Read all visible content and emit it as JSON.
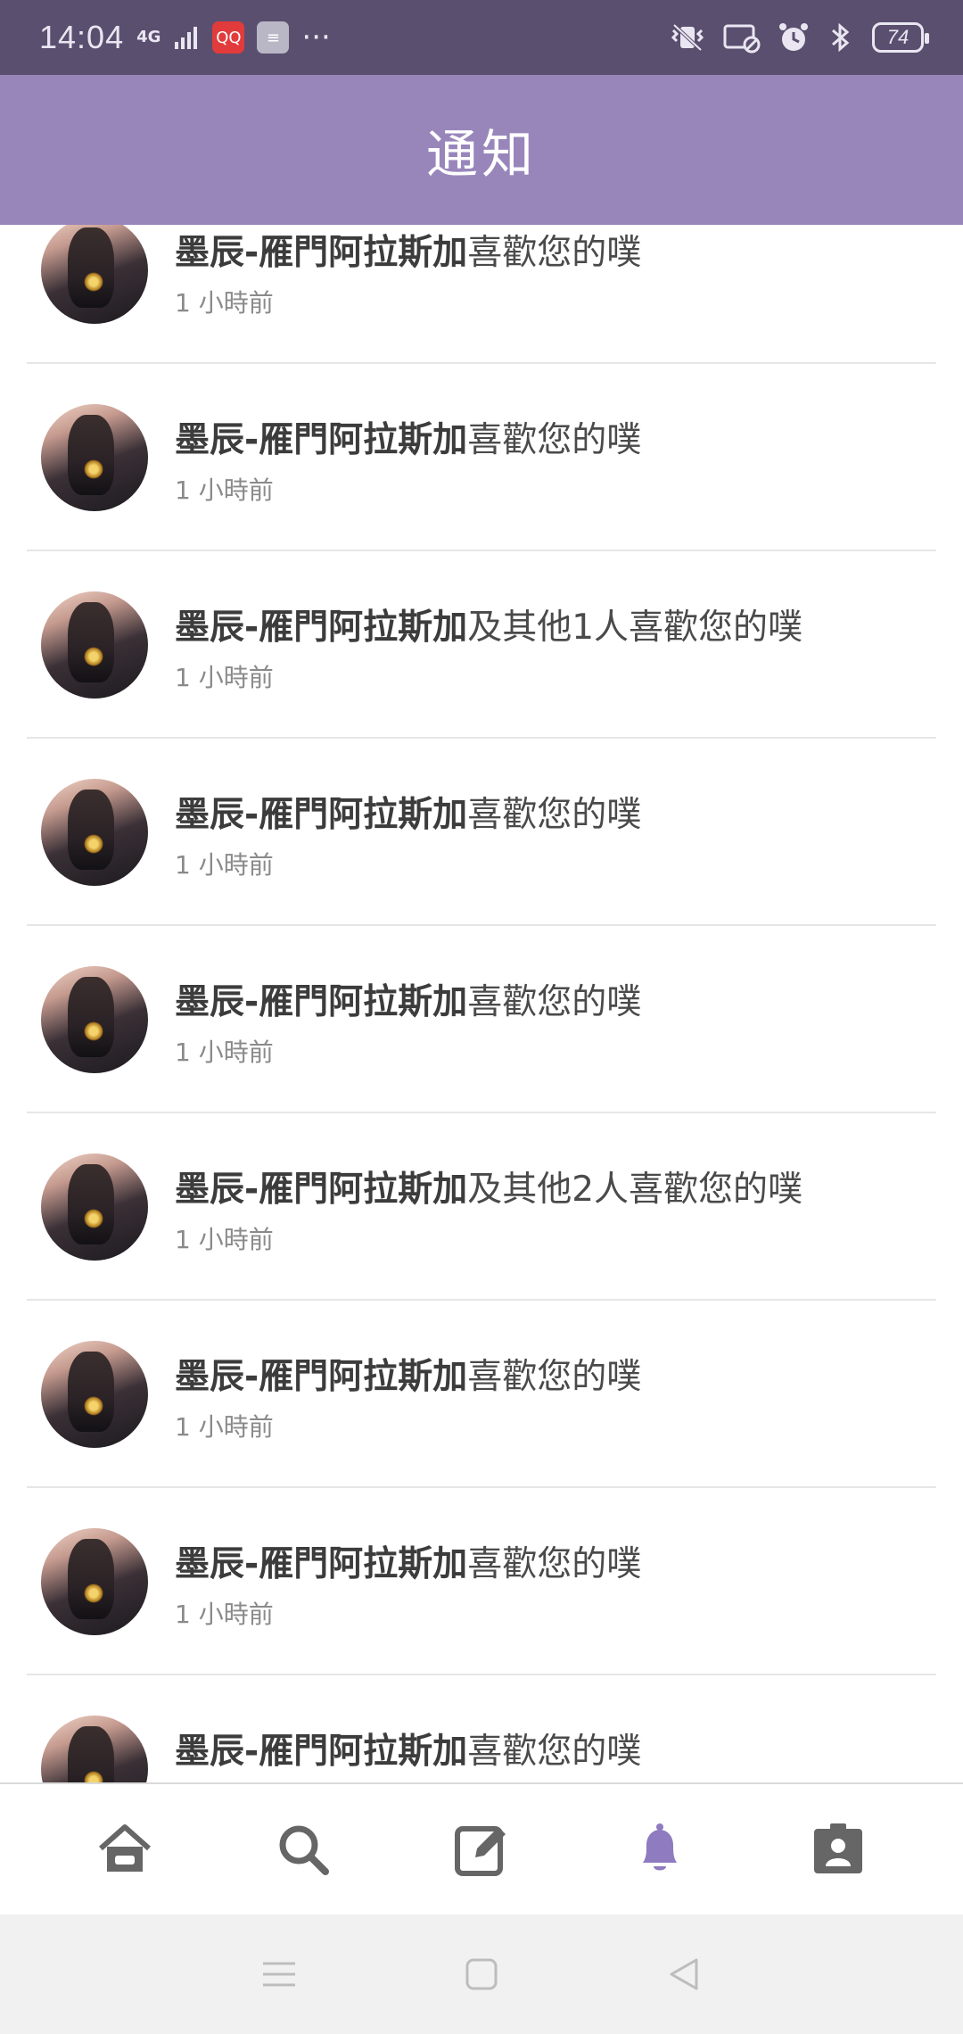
{
  "status_bar": {
    "time": "14:04",
    "network": "4G",
    "app_badge_red": "QQ",
    "more": "···",
    "battery": "74"
  },
  "header": {
    "title": "通知"
  },
  "notifications": [
    {
      "user": "墨辰-雁門阿拉斯加",
      "action": "喜歡您的噗",
      "time": "1 小時前"
    },
    {
      "user": "墨辰-雁門阿拉斯加",
      "action": "喜歡您的噗",
      "time": "1 小時前"
    },
    {
      "user": "墨辰-雁門阿拉斯加",
      "action": "及其他1人喜歡您的噗",
      "time": "1 小時前"
    },
    {
      "user": "墨辰-雁門阿拉斯加",
      "action": "喜歡您的噗",
      "time": "1 小時前"
    },
    {
      "user": "墨辰-雁門阿拉斯加",
      "action": "喜歡您的噗",
      "time": "1 小時前"
    },
    {
      "user": "墨辰-雁門阿拉斯加",
      "action": "及其他2人喜歡您的噗",
      "time": "1 小時前"
    },
    {
      "user": "墨辰-雁門阿拉斯加",
      "action": "喜歡您的噗",
      "time": "1 小時前"
    },
    {
      "user": "墨辰-雁門阿拉斯加",
      "action": "喜歡您的噗",
      "time": "1 小時前"
    },
    {
      "user": "墨辰-雁門阿拉斯加",
      "action": "喜歡您的噗",
      "time": ""
    }
  ],
  "bottom_nav": {
    "items": [
      {
        "icon": "home-icon",
        "active": false
      },
      {
        "icon": "search-icon",
        "active": false
      },
      {
        "icon": "compose-icon",
        "active": false
      },
      {
        "icon": "bell-icon",
        "active": true
      },
      {
        "icon": "profile-card-icon",
        "active": false
      }
    ],
    "active_color": "#8f7bc0",
    "inactive_color": "#666666"
  },
  "system_nav": {
    "icons": [
      "menu-icon",
      "home-square-icon",
      "back-triangle-icon"
    ]
  },
  "colors": {
    "status_bar": "#5a4f6f",
    "header": "#9886bb"
  }
}
